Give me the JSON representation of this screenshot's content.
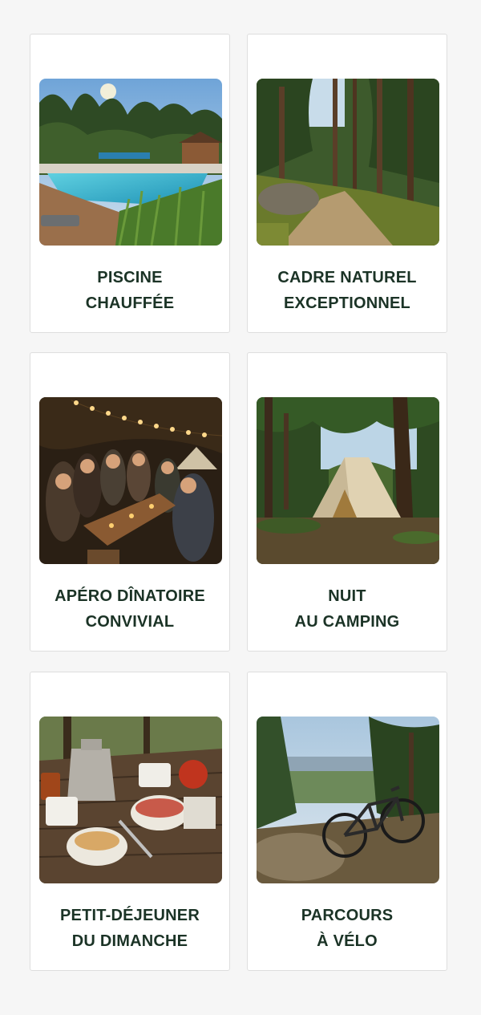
{
  "cards": [
    {
      "line1": "PISCINE",
      "line2": "CHAUFFÉE",
      "image_name": "heated-pool-photo"
    },
    {
      "line1": "CADRE NATUREL",
      "line2": "EXCEPTIONNEL",
      "image_name": "forest-path-photo"
    },
    {
      "line1": "APÉRO DÎNATOIRE",
      "line2": "CONVIVIAL",
      "image_name": "group-dinner-photo"
    },
    {
      "line1": "NUIT",
      "line2": "AU CAMPING",
      "image_name": "camping-tent-photo"
    },
    {
      "line1": "PETIT-DÉJEUNER",
      "line2": "DU DIMANCHE",
      "image_name": "breakfast-table-photo"
    },
    {
      "line1": "PARCOURS",
      "line2": "À VÉLO",
      "image_name": "mountain-bike-photo"
    }
  ],
  "colors": {
    "title": "#1b3326",
    "page_bg": "#f6f6f6",
    "card_border": "#dedede"
  }
}
